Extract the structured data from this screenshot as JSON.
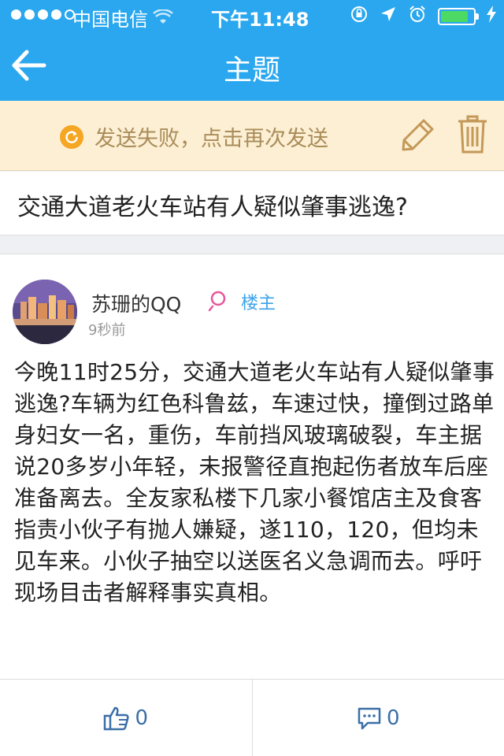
{
  "status_bar": {
    "carrier": "中国电信",
    "time": "下午11:48",
    "signal_bars_filled": 4,
    "signal_bars_total": 5,
    "battery_level": 0.85,
    "icons": [
      "wifi-icon",
      "orientation-lock-icon",
      "location-arrow-icon",
      "alarm-icon",
      "battery-icon",
      "charging-bolt-icon"
    ]
  },
  "nav": {
    "title": "主题",
    "back_icon": "back-arrow-icon"
  },
  "fail_bar": {
    "message": "发送失败，点击再次发送",
    "icons": [
      "retry-icon",
      "pencil-edit-icon",
      "trash-icon"
    ]
  },
  "topic": {
    "title": "交通大道老火车站有人疑似肇事逃逸?"
  },
  "post": {
    "author": "苏珊的QQ",
    "badge": "楼主",
    "time": "9秒前",
    "body": "今晚11时25分，交通大道老火车站有人疑似肇事逃逸?车辆为红色科鲁兹，车速过快，撞倒过路单身妇女一名，重伤，车前挡风玻璃破裂，车主据说20多岁小年轻，未报警径直抱起伤者放车后座准备离去。全友家私楼下几家小餐馆店主及食客指责小伙子有抛人嫌疑，遂110，120，但均未见车来。小伙子抽空以送医名义急调而去。呼吁现场目击者解释事实真相。"
  },
  "actions": {
    "like_count": "0",
    "comment_count": "0",
    "icons": [
      "thumbs-up-icon",
      "comment-icon"
    ]
  },
  "colors": {
    "header_blue": "#2aa7ee",
    "fail_bar_bg": "#fcefd3",
    "fail_text": "#aa8c5a",
    "retry_orange": "#f5a623",
    "badge_blue": "#3ba3e8",
    "battery_green": "#4cd964",
    "female_pink": "#e8559a"
  }
}
